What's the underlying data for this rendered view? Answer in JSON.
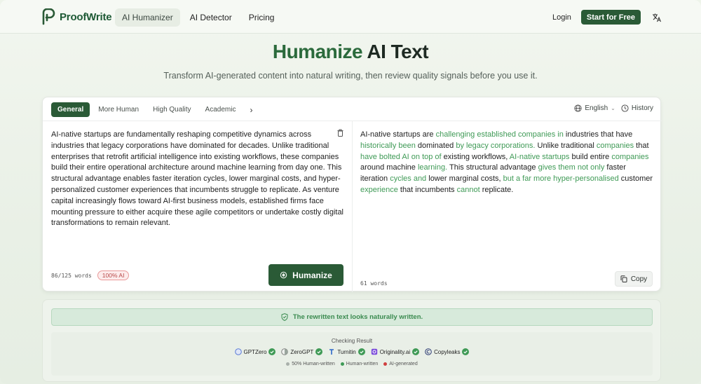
{
  "nav": {
    "logo_text": "ProofWrite",
    "links": [
      "AI Humanizer",
      "AI Detector",
      "Pricing"
    ],
    "login": "Login",
    "cta": "Start for Free",
    "language_icon": "translate-icon"
  },
  "hero": {
    "title_green": "Humanize",
    "title_dark": "AI Text",
    "subtitle": "Transform AI-generated content into natural writing, then review quality signals before you use it."
  },
  "editor": {
    "tabs": [
      "General",
      "More Human",
      "High Quality",
      "Academic"
    ],
    "active_tab": "General",
    "more_tabs": "›",
    "language": "English",
    "history": "History",
    "input_text": "AI-native startups are fundamentally reshaping competitive dynamics across industries that legacy corporations have dominated for decades. Unlike traditional enterprises that retrofit artificial intelligence into existing workflows, these companies build their entire operational architecture around machine learning from day one. This structural advantage enables faster iteration cycles, lower marginal costs, and hyper-personalized customer experiences that incumbents struggle to replicate. As venture capital increasingly flows toward AI-first business models, established firms face mounting pressure to either acquire these agile competitors or undertake costly digital transformations to remain relevant.",
    "input_word_count": "86/125 words",
    "ai_badge": "100% AI",
    "humanize_button": "Humanize",
    "output_segments": [
      {
        "t": "AI-native startups are ",
        "h": false
      },
      {
        "t": "challenging established companies in",
        "h": true
      },
      {
        "t": " industries that have ",
        "h": false
      },
      {
        "t": "historically been",
        "h": true
      },
      {
        "t": " dominated ",
        "h": false
      },
      {
        "t": "by legacy corporations.",
        "h": true
      },
      {
        "t": " Unlike traditional ",
        "h": false
      },
      {
        "t": "companies",
        "h": true
      },
      {
        "t": " that ",
        "h": false
      },
      {
        "t": "have bolted AI on top of",
        "h": true
      },
      {
        "t": " existing workflows, ",
        "h": false
      },
      {
        "t": "AI-native startups",
        "h": true
      },
      {
        "t": " build entire ",
        "h": false
      },
      {
        "t": "companies",
        "h": true
      },
      {
        "t": " around machine ",
        "h": false
      },
      {
        "t": "learning.",
        "h": true
      },
      {
        "t": " This structural advantage ",
        "h": false
      },
      {
        "t": "gives them not only",
        "h": true
      },
      {
        "t": " faster iteration ",
        "h": false
      },
      {
        "t": "cycles and",
        "h": true
      },
      {
        "t": " lower marginal costs, ",
        "h": false
      },
      {
        "t": "but a far more hyper-personalised",
        "h": true
      },
      {
        "t": " customer ",
        "h": false
      },
      {
        "t": "experience",
        "h": true
      },
      {
        "t": " that incumbents ",
        "h": false
      },
      {
        "t": "cannot",
        "h": true
      },
      {
        "t": " replicate.",
        "h": false
      }
    ],
    "output_word_count": "61 words",
    "copy_button": "Copy",
    "highlight_color": "#3f9a56"
  },
  "result": {
    "banner": "The rewritten text looks naturally written.",
    "checking_title": "Checking Result",
    "detectors": [
      {
        "name": "GPTZero",
        "icon": "gptzero-logo-icon"
      },
      {
        "name": "ZeroGPT",
        "icon": "zerogpt-logo-icon"
      },
      {
        "name": "Turnitin",
        "icon": "turnitin-logo-icon"
      },
      {
        "name": "Originality.ai",
        "icon": "originality-logo-icon"
      },
      {
        "name": "Copyleaks",
        "icon": "copyleaks-logo-icon"
      }
    ],
    "legend": [
      {
        "label": "50% Human-written",
        "color": "#a9b0ab"
      },
      {
        "label": "Human-written",
        "color": "#3f9a56"
      },
      {
        "label": "AI-generated",
        "color": "#d04040"
      }
    ]
  },
  "colors": {
    "brand_green": "#2a5a36",
    "accent_green": "#3f9a56",
    "ai_red": "#b84848"
  }
}
